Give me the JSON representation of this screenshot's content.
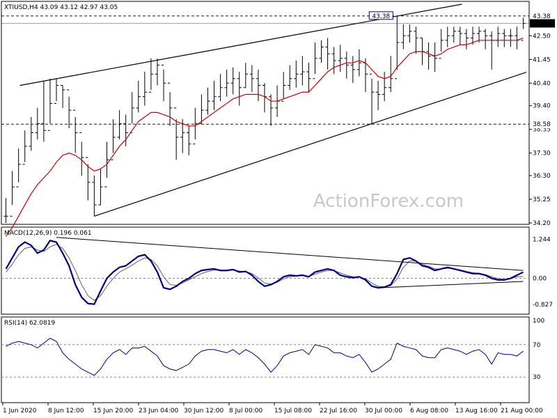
{
  "chart_data": {
    "type": "line",
    "symbol_header": "XTIUSD,H4  43.09 43.12 42.97 43.05",
    "watermark": "ActionForex.com",
    "colors": {
      "price": "#000000",
      "ma": "#cc0000",
      "macd": "#000080",
      "signal": "#606060",
      "rsi": "#000080",
      "trendline": "#000000"
    },
    "x_tick_labels": [
      "1 Jun 2020",
      "8 Jun 12:00",
      "15 Jun 20:00",
      "23 Jun 04:00",
      "30 Jun 12:00",
      "8 Jul 00:00",
      "15 Jul 08:00",
      "22 Jul 16:00",
      "30 Jul 00:00",
      "6 Aug 08:00",
      "13 Aug 16:00",
      "21 Aug 00:00"
    ],
    "price_panel": {
      "y_tick_labels": [
        "42.50",
        "41.45",
        "40.40",
        "39.40",
        "38.35",
        "37.30",
        "36.30",
        "35.25",
        "34.20"
      ],
      "ylim": [
        34.2,
        43.9
      ],
      "current_label": "43.05",
      "high_label": "43.38",
      "level_label": "38.58",
      "levels": [
        43.38,
        43.05,
        38.58
      ],
      "close": [
        34.5,
        35.8,
        36.8,
        37.6,
        38.2,
        38.6,
        38.3,
        39.5,
        40.3,
        40.1,
        39.2,
        38.2,
        37.1,
        36.0,
        35.0,
        35.8,
        37.0,
        38.0,
        38.6,
        38.2,
        39.3,
        39.8,
        40.0,
        40.8,
        41.2,
        40.4,
        39.3,
        38.0,
        38.2,
        37.7,
        38.6,
        39.2,
        39.6,
        39.8,
        40.2,
        40.4,
        40.6,
        40.2,
        40.8,
        40.6,
        40.3,
        39.8,
        39.3,
        39.6,
        40.3,
        40.6,
        40.8,
        40.9,
        40.6,
        41.5,
        42.0,
        41.7,
        41.4,
        41.5,
        41.2,
        41.0,
        41.3,
        40.8,
        40.0,
        39.9,
        40.2,
        40.6,
        42.2,
        42.5,
        42.7,
        42.4,
        41.8,
        41.6,
        41.5,
        42.3,
        42.5,
        42.7,
        42.6,
        42.4,
        42.6,
        42.7,
        42.5,
        42.3,
        42.6,
        42.5,
        42.5,
        42.3,
        43.05
      ],
      "high": [
        35.3,
        36.5,
        37.5,
        38.3,
        38.9,
        39.3,
        40.5,
        40.6,
        40.6,
        40.3,
        39.8,
        38.9,
        37.8,
        36.8,
        36.3,
        36.6,
        37.8,
        38.8,
        39.2,
        39.0,
        40.0,
        40.5,
        40.9,
        41.5,
        41.5,
        41.0,
        40.0,
        38.8,
        38.8,
        38.5,
        39.3,
        39.9,
        40.2,
        40.5,
        40.8,
        41.0,
        41.1,
        40.9,
        41.3,
        41.2,
        41.0,
        40.4,
        39.9,
        40.3,
        40.9,
        41.2,
        41.4,
        41.6,
        41.3,
        42.2,
        42.3,
        42.4,
        42.0,
        42.1,
        41.8,
        41.6,
        41.9,
        41.5,
        40.6,
        40.5,
        40.9,
        41.6,
        43.38,
        43.0,
        43.0,
        42.9,
        42.4,
        42.2,
        42.2,
        42.8,
        42.9,
        42.9,
        42.9,
        42.8,
        42.9,
        42.9,
        42.8,
        42.7,
        42.9,
        42.8,
        42.8,
        42.9,
        43.3
      ],
      "low": [
        34.2,
        35.0,
        36.0,
        36.9,
        37.4,
        37.9,
        37.8,
        38.6,
        39.6,
        39.3,
        38.4,
        37.3,
        36.3,
        35.2,
        34.5,
        35.0,
        36.2,
        37.3,
        37.9,
        37.6,
        38.6,
        39.1,
        39.4,
        40.1,
        40.3,
        39.6,
        38.5,
        37.0,
        37.3,
        37.2,
        37.9,
        38.6,
        39.0,
        39.2,
        39.6,
        39.8,
        39.9,
        39.4,
        40.2,
        40.0,
        39.6,
        39.1,
        38.5,
        38.9,
        39.7,
        40.1,
        40.2,
        40.3,
        40.0,
        40.8,
        41.3,
        41.0,
        40.8,
        40.9,
        40.6,
        40.4,
        40.7,
        40.0,
        38.6,
        39.2,
        39.6,
        40.0,
        41.0,
        41.9,
        42.2,
        41.7,
        41.2,
        41.0,
        40.9,
        41.8,
        42.0,
        42.2,
        42.1,
        41.9,
        42.1,
        42.2,
        41.9,
        41.0,
        42.0,
        42.0,
        42.0,
        41.9,
        42.8
      ],
      "ma": [
        33.6,
        34.0,
        34.5,
        35.0,
        35.5,
        35.9,
        36.2,
        36.5,
        36.9,
        37.2,
        37.3,
        37.2,
        37.0,
        36.7,
        36.5,
        36.6,
        36.8,
        37.2,
        37.6,
        37.9,
        38.3,
        38.7,
        38.9,
        39.1,
        39.1,
        39.0,
        38.9,
        38.7,
        38.6,
        38.5,
        38.5,
        38.7,
        38.9,
        39.1,
        39.3,
        39.5,
        39.7,
        39.8,
        39.9,
        39.9,
        39.9,
        39.8,
        39.6,
        39.6,
        39.7,
        39.8,
        39.9,
        40.0,
        40.0,
        40.3,
        40.6,
        40.9,
        41.1,
        41.2,
        41.3,
        41.3,
        41.4,
        41.3,
        41.0,
        40.7,
        40.6,
        40.7,
        41.1,
        41.4,
        41.7,
        41.8,
        41.8,
        41.7,
        41.6,
        41.7,
        41.9,
        42.0,
        42.1,
        42.1,
        42.2,
        42.3,
        42.3,
        42.3,
        42.3,
        42.3,
        42.3,
        42.3,
        42.4
      ]
    },
    "macd_panel": {
      "label": "MACD(12,26,9) 0.196 0.061",
      "y_tick_labels": [
        "1.244",
        "0.00",
        "-0.827"
      ],
      "ylim": [
        -1.05,
        1.45
      ],
      "macd": [
        0.3,
        0.65,
        1.0,
        1.15,
        1.05,
        0.8,
        0.9,
        1.2,
        1.15,
        0.8,
        0.4,
        -0.2,
        -0.6,
        -0.8,
        -0.82,
        -0.4,
        0.0,
        0.2,
        0.35,
        0.4,
        0.55,
        0.7,
        0.75,
        0.55,
        0.2,
        -0.3,
        -0.35,
        -0.25,
        -0.1,
        0.0,
        0.15,
        0.25,
        0.28,
        0.3,
        0.25,
        0.25,
        0.28,
        0.2,
        0.22,
        0.1,
        -0.1,
        -0.25,
        -0.2,
        -0.1,
        0.05,
        0.1,
        0.08,
        0.1,
        0.05,
        0.2,
        0.25,
        0.3,
        0.25,
        0.1,
        0.05,
        0.02,
        0.05,
        -0.05,
        -0.25,
        -0.3,
        -0.28,
        -0.2,
        0.15,
        0.6,
        0.65,
        0.55,
        0.4,
        0.35,
        0.25,
        0.3,
        0.35,
        0.3,
        0.25,
        0.2,
        0.15,
        0.15,
        0.1,
        0.0,
        -0.05,
        -0.05,
        0.0,
        0.1,
        0.196
      ],
      "signal": [
        0.2,
        0.45,
        0.75,
        0.95,
        1.0,
        0.9,
        0.85,
        1.0,
        1.08,
        0.95,
        0.65,
        0.25,
        -0.2,
        -0.55,
        -0.7,
        -0.55,
        -0.25,
        0.0,
        0.2,
        0.3,
        0.42,
        0.55,
        0.65,
        0.6,
        0.4,
        0.05,
        -0.2,
        -0.22,
        -0.15,
        -0.05,
        0.05,
        0.15,
        0.22,
        0.26,
        0.26,
        0.25,
        0.26,
        0.23,
        0.22,
        0.15,
        0.02,
        -0.15,
        -0.18,
        -0.12,
        -0.02,
        0.05,
        0.07,
        0.09,
        0.07,
        0.13,
        0.2,
        0.25,
        0.25,
        0.17,
        0.1,
        0.05,
        0.04,
        -0.01,
        -0.15,
        -0.25,
        -0.27,
        -0.23,
        -0.02,
        0.35,
        0.55,
        0.55,
        0.45,
        0.38,
        0.3,
        0.3,
        0.32,
        0.31,
        0.27,
        0.22,
        0.18,
        0.16,
        0.12,
        0.05,
        -0.01,
        -0.03,
        -0.01,
        0.05,
        0.061
      ]
    },
    "rsi_panel": {
      "label": "RSI(14) 62.0819",
      "y_tick_labels": [
        "100",
        "70",
        "30",
        "0"
      ],
      "ylim": [
        0,
        100
      ],
      "levels": [
        70,
        30
      ],
      "rsi": [
        68,
        72,
        74,
        72,
        70,
        66,
        72,
        78,
        74,
        60,
        52,
        46,
        40,
        36,
        32,
        40,
        52,
        60,
        64,
        58,
        66,
        66,
        68,
        62,
        56,
        44,
        40,
        38,
        42,
        46,
        56,
        62,
        64,
        64,
        62,
        60,
        64,
        58,
        64,
        60,
        54,
        46,
        36,
        44,
        56,
        60,
        62,
        64,
        58,
        70,
        68,
        66,
        60,
        60,
        56,
        54,
        58,
        48,
        36,
        40,
        46,
        52,
        72,
        68,
        66,
        64,
        56,
        54,
        54,
        64,
        66,
        64,
        62,
        58,
        62,
        64,
        58,
        46,
        60,
        58,
        58,
        56,
        62
      ]
    }
  }
}
